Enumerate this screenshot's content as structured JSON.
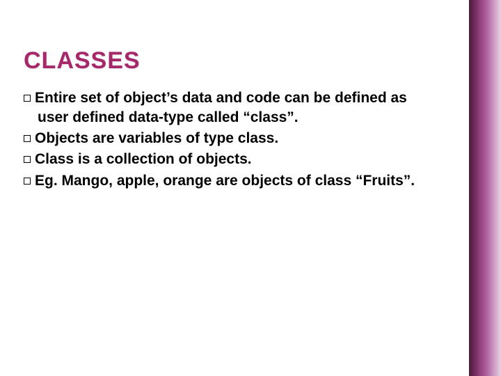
{
  "title": "CLASSES",
  "bullets": {
    "b1": "Entire set of object’s data and code can be defined as user defined data-type called “class”.",
    "b2": "Objects are variables of type class.",
    "b3": "Class is a collection of objects.",
    "b4": "Eg. Mango, apple, orange are objects of class “Fruits”."
  }
}
